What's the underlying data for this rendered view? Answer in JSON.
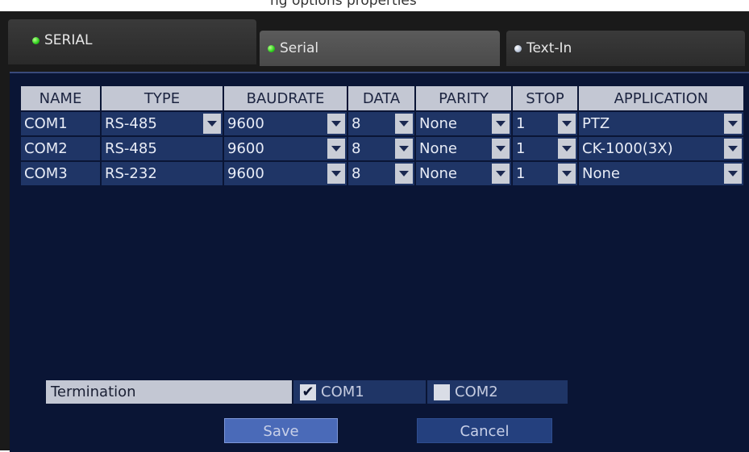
{
  "top_text": "ng options properties",
  "section": {
    "label": "SERIAL",
    "indicator": "green"
  },
  "tabs": [
    {
      "label": "Serial",
      "indicator": "green",
      "active": true
    },
    {
      "label": "Text-In",
      "indicator": "gray",
      "active": false
    }
  ],
  "table": {
    "headers": [
      "NAME",
      "TYPE",
      "BAUDRATE",
      "DATA",
      "PARITY",
      "STOP",
      "APPLICATION"
    ],
    "rows": [
      {
        "name": "COM1",
        "type": "RS-485",
        "baudrate": "9600",
        "data": "8",
        "parity": "None",
        "stop": "1",
        "application": "PTZ"
      },
      {
        "name": "COM2",
        "type": "RS-485",
        "baudrate": "9600",
        "data": "8",
        "parity": "None",
        "stop": "1",
        "application": "CK-1000(3X)"
      },
      {
        "name": "COM3",
        "type": "RS-232",
        "baudrate": "9600",
        "data": "8",
        "parity": "None",
        "stop": "1",
        "application": "None"
      }
    ]
  },
  "termination": {
    "label": "Termination",
    "options": [
      {
        "label": "COM1",
        "checked": true
      },
      {
        "label": "COM2",
        "checked": false
      }
    ]
  },
  "buttons": {
    "save": "Save",
    "cancel": "Cancel"
  },
  "colors": {
    "panel_bg": "#0a1535",
    "cell_bg": "#1f3566",
    "header_bg": "#c3c7d3",
    "save_bg": "#4a6ab8",
    "cancel_bg": "#24407e"
  }
}
